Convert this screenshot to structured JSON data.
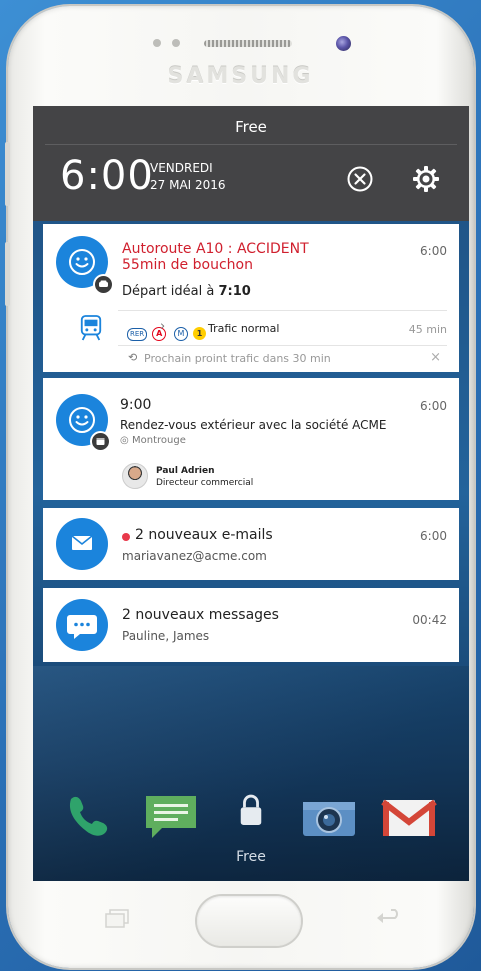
{
  "device": {
    "brand": "SAMSUNG"
  },
  "status_bar": {
    "carrier": "Free",
    "time": "6:00",
    "day": "VENDREDI",
    "date": "27 MAI 2016"
  },
  "notifications": [
    {
      "title_line1": "Autoroute A10 : ACCIDENT",
      "title_line2": "55min de bouchon",
      "time": "6:00",
      "departure_prefix": "Départ idéal à ",
      "departure_time": "7:10",
      "transit_status": "Trafic normal",
      "transit_duration": "45 min",
      "next_check": "Prochain proint trafic dans 30 min",
      "rer_label": "RER",
      "rer_line": "A",
      "metro_label": "M",
      "metro_line": "1",
      "colors": {
        "alert": "#d0202e",
        "accent": "#1b84dc"
      }
    },
    {
      "title": "9:00",
      "time": "6:00",
      "subject": "Rendez-vous extérieur avec la société ACME",
      "location": "Montrouge",
      "contact_name": "Paul Adrien",
      "contact_role": "Directeur commercial"
    },
    {
      "title": "2 nouveaux e-mails",
      "time": "6:00",
      "subtitle": "mariavanez@acme.com",
      "unread_color": "#e8394b"
    },
    {
      "title": "2 nouveaux messages",
      "time": "00:42",
      "subtitle": "Pauline, James"
    }
  ],
  "dock": {
    "apps": [
      "phone-icon",
      "messages-icon",
      "lock-icon",
      "camera-icon",
      "gmail-icon"
    ],
    "label": "Free"
  }
}
